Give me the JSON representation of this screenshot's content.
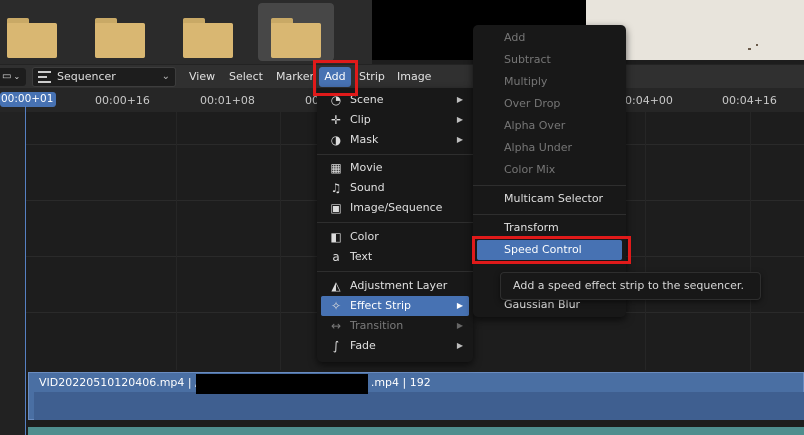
{
  "header": {
    "editor_type_icon": "film-icon",
    "mode": "Sequencer",
    "menus": [
      "View",
      "Select",
      "Marker",
      "Add",
      "Strip",
      "Image"
    ]
  },
  "timeline": {
    "current_frame": "00:00+01",
    "ticks": [
      "00:00+16",
      "00:01+08",
      "00:04+00",
      "00:04+16"
    ]
  },
  "strip": {
    "label_start": "VID20220510120406.mp4 | /",
    "label_end": ".mp4 | 192"
  },
  "add_menu": {
    "items": [
      {
        "label": "Scene",
        "icon": "scene-icon",
        "sub": true
      },
      {
        "label": "Clip",
        "icon": "clip-icon",
        "sub": true
      },
      {
        "label": "Mask",
        "icon": "mask-icon",
        "sub": true
      },
      {
        "label": "Movie",
        "icon": "movie-icon"
      },
      {
        "label": "Sound",
        "icon": "sound-icon"
      },
      {
        "label": "Image/Sequence",
        "icon": "image-icon"
      },
      {
        "label": "Color",
        "icon": "color-icon"
      },
      {
        "label": "Text",
        "icon": "text-icon"
      },
      {
        "label": "Adjustment Layer",
        "icon": "adjustment-icon"
      },
      {
        "label": "Effect Strip",
        "icon": "effect-icon",
        "sub": true
      },
      {
        "label": "Transition",
        "icon": "transition-icon",
        "sub": true
      },
      {
        "label": "Fade",
        "icon": "fade-icon",
        "sub": true
      }
    ]
  },
  "effect_menu": {
    "items": [
      "Add",
      "Subtract",
      "Multiply",
      "Over Drop",
      "Alpha Over",
      "Alpha Under",
      "Color Mix",
      "Multicam Selector",
      "Transform",
      "Speed Control",
      "Gaussian Blur"
    ]
  },
  "tooltip": "Add a speed effect strip to the sequencer.",
  "colors": {
    "accent": "#4772b3",
    "highlight_box": "#e01a1a",
    "strip": "#4a6fa3"
  }
}
